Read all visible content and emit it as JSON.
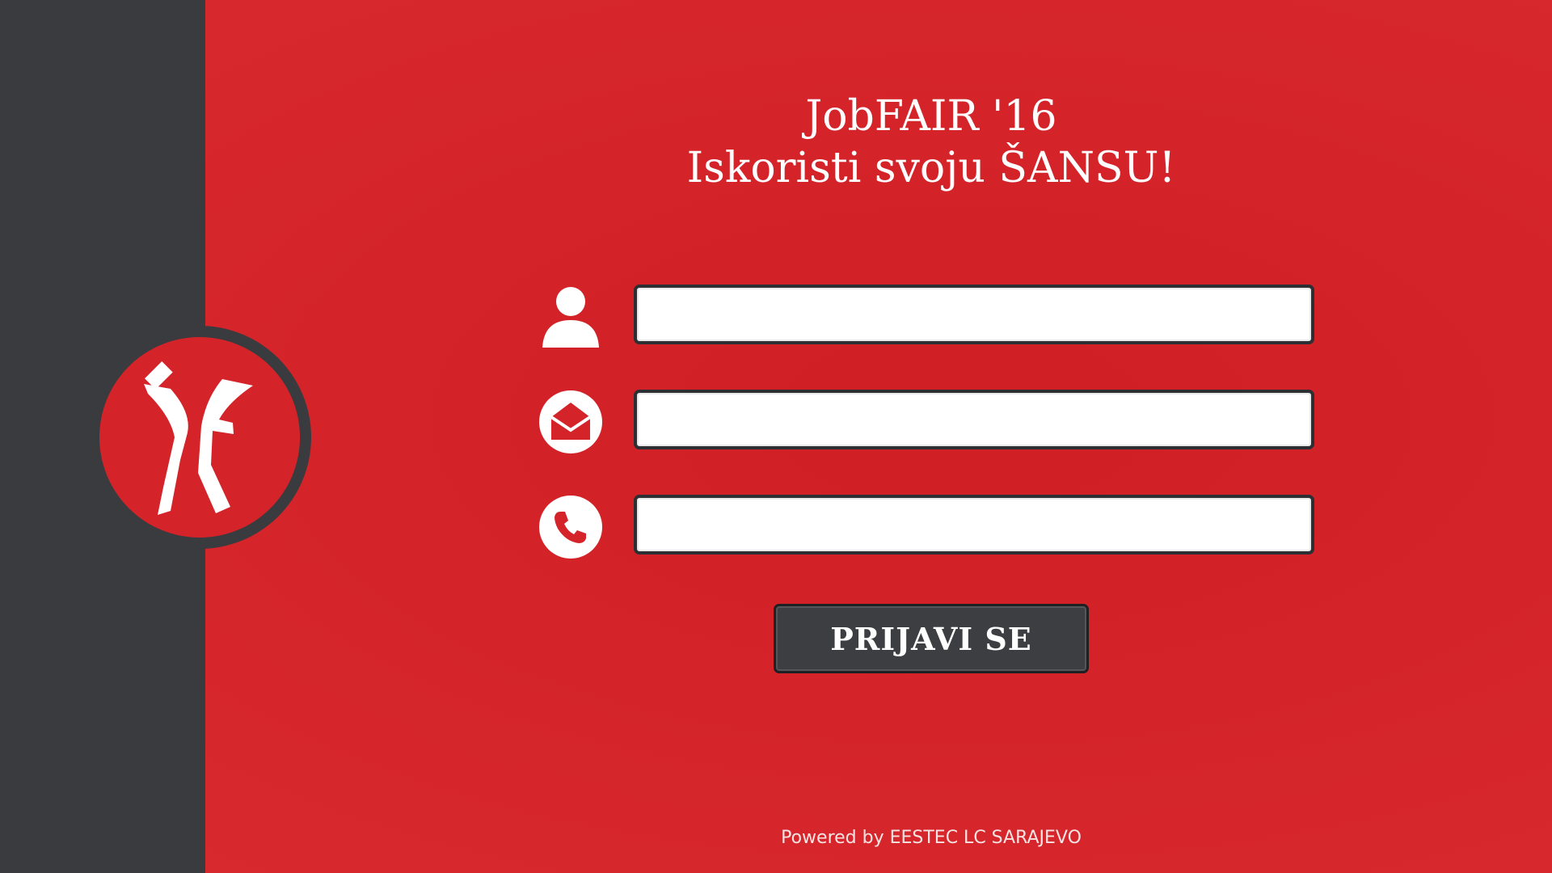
{
  "header": {
    "title": "JobFAIR '16",
    "subtitle": "Iskoristi svoju ŠANSU!"
  },
  "form": {
    "fields": [
      {
        "icon": "user-icon",
        "value": "",
        "placeholder": ""
      },
      {
        "icon": "email-icon",
        "value": "",
        "placeholder": ""
      },
      {
        "icon": "phone-icon",
        "value": "",
        "placeholder": ""
      }
    ],
    "submit_label": "PRIJAVI SE"
  },
  "footer": {
    "text": "Powered by EESTEC LC SARAJEVO"
  },
  "logo": {
    "icon": "jobfair-logo"
  },
  "colors": {
    "background_red": "#d4242a",
    "sidebar_dark": "#3a3b3e",
    "button_dark": "#3d3e41",
    "text_white": "#ffffff"
  }
}
